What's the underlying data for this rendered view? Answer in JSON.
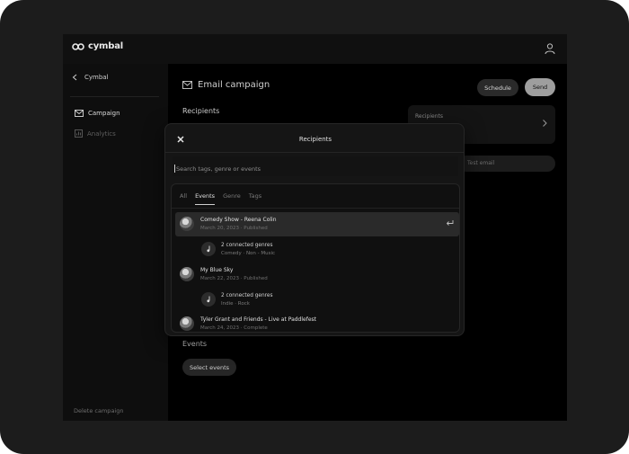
{
  "app": {
    "brand": "cymbal"
  },
  "sidebar": {
    "back_label": "Cymbal",
    "items": [
      {
        "label": "Campaign",
        "active": true
      },
      {
        "label": "Analytics",
        "active": false
      }
    ],
    "delete_label": "Delete campaign"
  },
  "main": {
    "title": "Email campaign",
    "schedule_label": "Schedule",
    "send_label": "Send",
    "recipients_heading": "Recipients",
    "recipients_card_label": "Recipients",
    "test_email_placeholder": "Test email",
    "events_heading": "Events",
    "select_events_label": "Select events"
  },
  "modal": {
    "title": "Recipients",
    "search_placeholder": "Search tags, genre or events",
    "tabs": [
      {
        "label": "All",
        "active": false
      },
      {
        "label": "Events",
        "active": true
      },
      {
        "label": "Genre",
        "active": false
      },
      {
        "label": "Tags",
        "active": false
      }
    ],
    "results": [
      {
        "title": "Comedy Show - Reena Colin",
        "date": "March 20, 2023",
        "status": "Published",
        "genres_title": "2 connected genres",
        "genres": "Comedy · Non - Music"
      },
      {
        "title": "My Blue Sky",
        "date": "March 22, 2023",
        "status": "Published",
        "genres_title": "2 connected genres",
        "genres": "Indie · Rock"
      },
      {
        "title": "Tyler Grant and Friends - Live at Paddlefest",
        "date": "March 24, 2023",
        "status": "Complete"
      }
    ]
  },
  "colors": {
    "background": "#000000",
    "surface": "#151515",
    "accent_button": "#9e9e9e"
  },
  "icons": [
    "cymbal-logo-icon",
    "user-icon",
    "chevron-left-icon",
    "mail-icon",
    "chart-icon",
    "close-icon",
    "chevron-right-icon",
    "enter-icon",
    "music-note-icon"
  ]
}
